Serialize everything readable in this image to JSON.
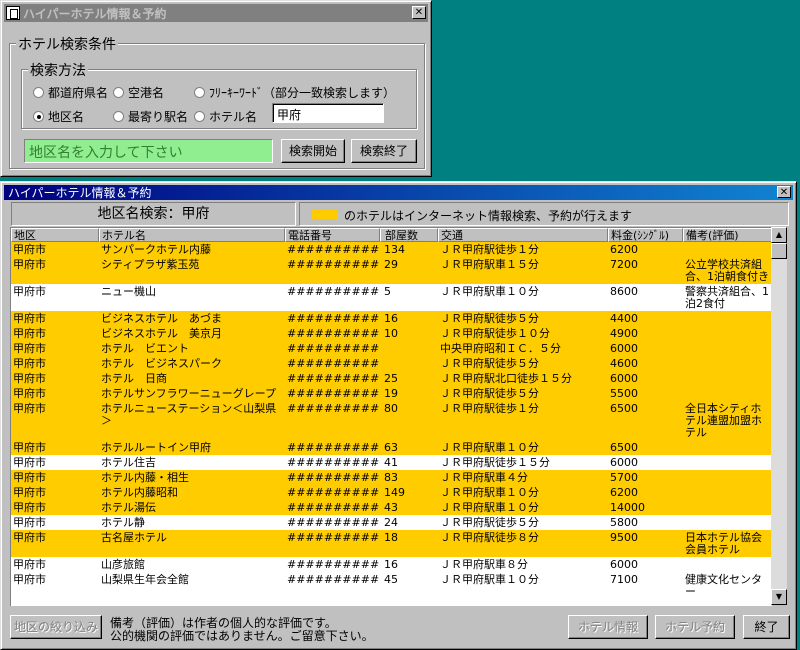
{
  "search_window": {
    "title": "ハイパーホテル情報＆予約",
    "close_glyph": "✕",
    "group_title": "ホテル検索条件",
    "method_title": "検索方法",
    "radios": {
      "prefecture": "都道府県名",
      "airport": "空港名",
      "freeword": "ﾌﾘｰｷｰﾜｰﾄﾞ（部分一致検索します）",
      "area": "地区名",
      "station": "最寄り駅名",
      "hotel": "ホテル名"
    },
    "selected_radio": "area",
    "input_value": "甲府",
    "hint": "地区名を入力して下さい",
    "start_button": "検索開始",
    "end_button": "検索終了"
  },
  "results_window": {
    "title": "ハイパーホテル情報＆予約",
    "close_glyph": "✕",
    "search_label": "地区名検索：甲府",
    "legend_text": "のホテルはインターネット情報検索、予約が行えます",
    "legend_color": "#ffcc00",
    "columns": [
      "地区",
      "ホテル名",
      "電話番号",
      "部屋数",
      "交通",
      "料金(ｼﾝｸﾞﾙ)",
      "備考(評価)"
    ],
    "rows": [
      {
        "hl": true,
        "area": "甲府市",
        "name": "サンパークホテル内藤",
        "phone": "############",
        "rooms": "134",
        "access": "ＪＲ甲府駅徒歩１分",
        "price": "6200",
        "note": ""
      },
      {
        "hl": true,
        "area": "甲府市",
        "name": "シティプラザ紫玉苑",
        "phone": "############",
        "rooms": "29",
        "access": "ＪＲ甲府駅車１５分",
        "price": "7200",
        "note": "公立学校共済組合、1泊朝食付き"
      },
      {
        "hl": false,
        "area": "甲府市",
        "name": "ニュー機山",
        "phone": "############",
        "rooms": "5",
        "access": "ＪＲ甲府駅車１０分",
        "price": "8600",
        "note": "警察共済組合、1泊2食付"
      },
      {
        "hl": true,
        "area": "甲府市",
        "name": "ビジネスホテル　あづま",
        "phone": "############",
        "rooms": "16",
        "access": "ＪＲ甲府駅徒歩５分",
        "price": "4400",
        "note": ""
      },
      {
        "hl": true,
        "area": "甲府市",
        "name": "ビジネスホテル　美京月",
        "phone": "############",
        "rooms": "10",
        "access": "ＪＲ甲府駅徒歩１０分",
        "price": "4900",
        "note": ""
      },
      {
        "hl": true,
        "area": "甲府市",
        "name": "ホテル　ビエント",
        "phone": "############",
        "rooms": "",
        "access": "中央甲府昭和ＩＣ．５分",
        "price": "6000",
        "note": ""
      },
      {
        "hl": true,
        "area": "甲府市",
        "name": "ホテル　ビジネスパーク",
        "phone": "############",
        "rooms": "",
        "access": "ＪＲ甲府駅徒歩５分",
        "price": "4600",
        "note": ""
      },
      {
        "hl": true,
        "area": "甲府市",
        "name": "ホテル　日商",
        "phone": "############",
        "rooms": "25",
        "access": "ＪＲ甲府駅北口徒歩１５分",
        "price": "6000",
        "note": ""
      },
      {
        "hl": true,
        "area": "甲府市",
        "name": "ホテルサンフラワーニューグレープ",
        "phone": "############",
        "rooms": "19",
        "access": "ＪＲ甲府駅徒歩５分",
        "price": "5500",
        "note": ""
      },
      {
        "hl": true,
        "area": "甲府市",
        "name": "ホテルニューステーション＜山梨県＞",
        "phone": "############",
        "rooms": "80",
        "access": "ＪＲ甲府駅徒歩１分",
        "price": "6500",
        "note": "全日本シティホテル連盟加盟ホテル"
      },
      {
        "hl": true,
        "area": "甲府市",
        "name": "ホテルルートイン甲府",
        "phone": "############",
        "rooms": "63",
        "access": "ＪＲ甲府駅車１０分",
        "price": "6500",
        "note": ""
      },
      {
        "hl": false,
        "area": "甲府市",
        "name": "ホテル住吉",
        "phone": "############",
        "rooms": "41",
        "access": "ＪＲ甲府駅徒歩１５分",
        "price": "6000",
        "note": ""
      },
      {
        "hl": true,
        "area": "甲府市",
        "name": "ホテル内藤・相生",
        "phone": "############",
        "rooms": "83",
        "access": "ＪＲ甲府駅車４分",
        "price": "5700",
        "note": ""
      },
      {
        "hl": true,
        "area": "甲府市",
        "name": "ホテル内藤昭和",
        "phone": "############",
        "rooms": "149",
        "access": "ＪＲ甲府駅車１０分",
        "price": "6200",
        "note": ""
      },
      {
        "hl": true,
        "area": "甲府市",
        "name": "ホテル湯伝",
        "phone": "############",
        "rooms": "43",
        "access": "ＪＲ甲府駅車１０分",
        "price": "14000",
        "note": ""
      },
      {
        "hl": false,
        "area": "甲府市",
        "name": "ホテル静",
        "phone": "############",
        "rooms": "24",
        "access": "ＪＲ甲府駅徒歩５分",
        "price": "5800",
        "note": ""
      },
      {
        "hl": true,
        "area": "甲府市",
        "name": "古名屋ホテル",
        "phone": "############",
        "rooms": "18",
        "access": "ＪＲ甲府駅徒歩８分",
        "price": "9500",
        "note": "日本ホテル協会会員ホテル"
      },
      {
        "hl": false,
        "area": "甲府市",
        "name": "山彦旅館",
        "phone": "############",
        "rooms": "16",
        "access": "ＪＲ甲府駅車８分",
        "price": "6000",
        "note": ""
      },
      {
        "hl": false,
        "area": "甲府市",
        "name": "山梨県生年会全館",
        "phone": "############",
        "rooms": "45",
        "access": "ＪＲ甲府駅車１０分",
        "price": "7100",
        "note": "健康文化センター"
      }
    ],
    "footer": {
      "filter_button": "地区の絞り込み",
      "note_line1": "備考（評価）は作者の個人的な評価です。",
      "note_line2": "公的機関の評価ではありません。ご留意下さい。",
      "info_button": "ホテル情報",
      "reserve_button": "ホテル予約",
      "exit_button": "終了"
    }
  }
}
